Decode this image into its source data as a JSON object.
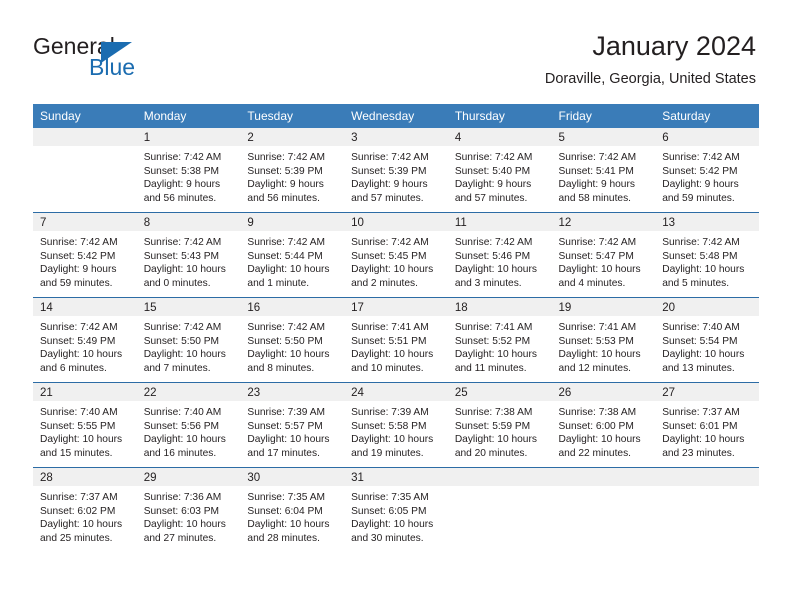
{
  "brand": {
    "name_part1": "General",
    "name_part2": "Blue",
    "accent_color": "#1b6cb0"
  },
  "header": {
    "title": "January 2024",
    "location": "Doraville, Georgia, United States"
  },
  "calendar": {
    "header_bg": "#3a7cb8",
    "daynum_bg": "#f0f0f0",
    "separator_color": "#2c6ca5",
    "weekdays": [
      "Sunday",
      "Monday",
      "Tuesday",
      "Wednesday",
      "Thursday",
      "Friday",
      "Saturday"
    ],
    "weeks": [
      [
        {
          "day": "",
          "lines": []
        },
        {
          "day": "1",
          "lines": [
            "Sunrise: 7:42 AM",
            "Sunset: 5:38 PM",
            "Daylight: 9 hours",
            "and 56 minutes."
          ]
        },
        {
          "day": "2",
          "lines": [
            "Sunrise: 7:42 AM",
            "Sunset: 5:39 PM",
            "Daylight: 9 hours",
            "and 56 minutes."
          ]
        },
        {
          "day": "3",
          "lines": [
            "Sunrise: 7:42 AM",
            "Sunset: 5:39 PM",
            "Daylight: 9 hours",
            "and 57 minutes."
          ]
        },
        {
          "day": "4",
          "lines": [
            "Sunrise: 7:42 AM",
            "Sunset: 5:40 PM",
            "Daylight: 9 hours",
            "and 57 minutes."
          ]
        },
        {
          "day": "5",
          "lines": [
            "Sunrise: 7:42 AM",
            "Sunset: 5:41 PM",
            "Daylight: 9 hours",
            "and 58 minutes."
          ]
        },
        {
          "day": "6",
          "lines": [
            "Sunrise: 7:42 AM",
            "Sunset: 5:42 PM",
            "Daylight: 9 hours",
            "and 59 minutes."
          ]
        }
      ],
      [
        {
          "day": "7",
          "lines": [
            "Sunrise: 7:42 AM",
            "Sunset: 5:42 PM",
            "Daylight: 9 hours",
            "and 59 minutes."
          ]
        },
        {
          "day": "8",
          "lines": [
            "Sunrise: 7:42 AM",
            "Sunset: 5:43 PM",
            "Daylight: 10 hours",
            "and 0 minutes."
          ]
        },
        {
          "day": "9",
          "lines": [
            "Sunrise: 7:42 AM",
            "Sunset: 5:44 PM",
            "Daylight: 10 hours",
            "and 1 minute."
          ]
        },
        {
          "day": "10",
          "lines": [
            "Sunrise: 7:42 AM",
            "Sunset: 5:45 PM",
            "Daylight: 10 hours",
            "and 2 minutes."
          ]
        },
        {
          "day": "11",
          "lines": [
            "Sunrise: 7:42 AM",
            "Sunset: 5:46 PM",
            "Daylight: 10 hours",
            "and 3 minutes."
          ]
        },
        {
          "day": "12",
          "lines": [
            "Sunrise: 7:42 AM",
            "Sunset: 5:47 PM",
            "Daylight: 10 hours",
            "and 4 minutes."
          ]
        },
        {
          "day": "13",
          "lines": [
            "Sunrise: 7:42 AM",
            "Sunset: 5:48 PM",
            "Daylight: 10 hours",
            "and 5 minutes."
          ]
        }
      ],
      [
        {
          "day": "14",
          "lines": [
            "Sunrise: 7:42 AM",
            "Sunset: 5:49 PM",
            "Daylight: 10 hours",
            "and 6 minutes."
          ]
        },
        {
          "day": "15",
          "lines": [
            "Sunrise: 7:42 AM",
            "Sunset: 5:50 PM",
            "Daylight: 10 hours",
            "and 7 minutes."
          ]
        },
        {
          "day": "16",
          "lines": [
            "Sunrise: 7:42 AM",
            "Sunset: 5:50 PM",
            "Daylight: 10 hours",
            "and 8 minutes."
          ]
        },
        {
          "day": "17",
          "lines": [
            "Sunrise: 7:41 AM",
            "Sunset: 5:51 PM",
            "Daylight: 10 hours",
            "and 10 minutes."
          ]
        },
        {
          "day": "18",
          "lines": [
            "Sunrise: 7:41 AM",
            "Sunset: 5:52 PM",
            "Daylight: 10 hours",
            "and 11 minutes."
          ]
        },
        {
          "day": "19",
          "lines": [
            "Sunrise: 7:41 AM",
            "Sunset: 5:53 PM",
            "Daylight: 10 hours",
            "and 12 minutes."
          ]
        },
        {
          "day": "20",
          "lines": [
            "Sunrise: 7:40 AM",
            "Sunset: 5:54 PM",
            "Daylight: 10 hours",
            "and 13 minutes."
          ]
        }
      ],
      [
        {
          "day": "21",
          "lines": [
            "Sunrise: 7:40 AM",
            "Sunset: 5:55 PM",
            "Daylight: 10 hours",
            "and 15 minutes."
          ]
        },
        {
          "day": "22",
          "lines": [
            "Sunrise: 7:40 AM",
            "Sunset: 5:56 PM",
            "Daylight: 10 hours",
            "and 16 minutes."
          ]
        },
        {
          "day": "23",
          "lines": [
            "Sunrise: 7:39 AM",
            "Sunset: 5:57 PM",
            "Daylight: 10 hours",
            "and 17 minutes."
          ]
        },
        {
          "day": "24",
          "lines": [
            "Sunrise: 7:39 AM",
            "Sunset: 5:58 PM",
            "Daylight: 10 hours",
            "and 19 minutes."
          ]
        },
        {
          "day": "25",
          "lines": [
            "Sunrise: 7:38 AM",
            "Sunset: 5:59 PM",
            "Daylight: 10 hours",
            "and 20 minutes."
          ]
        },
        {
          "day": "26",
          "lines": [
            "Sunrise: 7:38 AM",
            "Sunset: 6:00 PM",
            "Daylight: 10 hours",
            "and 22 minutes."
          ]
        },
        {
          "day": "27",
          "lines": [
            "Sunrise: 7:37 AM",
            "Sunset: 6:01 PM",
            "Daylight: 10 hours",
            "and 23 minutes."
          ]
        }
      ],
      [
        {
          "day": "28",
          "lines": [
            "Sunrise: 7:37 AM",
            "Sunset: 6:02 PM",
            "Daylight: 10 hours",
            "and 25 minutes."
          ]
        },
        {
          "day": "29",
          "lines": [
            "Sunrise: 7:36 AM",
            "Sunset: 6:03 PM",
            "Daylight: 10 hours",
            "and 27 minutes."
          ]
        },
        {
          "day": "30",
          "lines": [
            "Sunrise: 7:35 AM",
            "Sunset: 6:04 PM",
            "Daylight: 10 hours",
            "and 28 minutes."
          ]
        },
        {
          "day": "31",
          "lines": [
            "Sunrise: 7:35 AM",
            "Sunset: 6:05 PM",
            "Daylight: 10 hours",
            "and 30 minutes."
          ]
        },
        {
          "day": "",
          "lines": []
        },
        {
          "day": "",
          "lines": []
        },
        {
          "day": "",
          "lines": []
        }
      ]
    ]
  }
}
